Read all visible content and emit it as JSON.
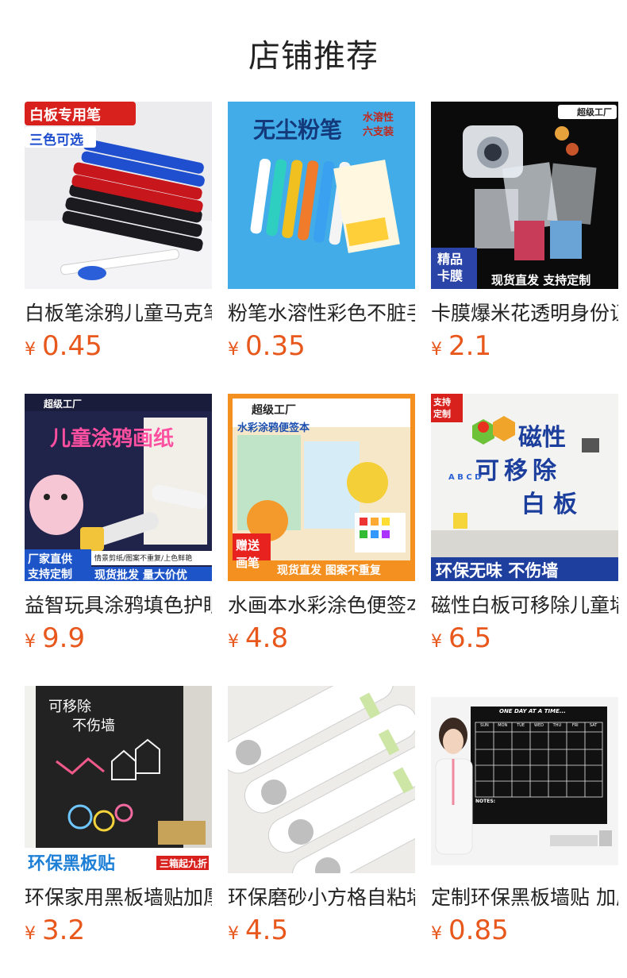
{
  "page": {
    "title": "店铺推荐",
    "currency": "¥"
  },
  "products": [
    {
      "name": "白板笔涂鸦儿童马克笔",
      "price": "0.45",
      "image_text": {
        "banner1": "白板专用笔",
        "banner2": "三色可选"
      }
    },
    {
      "name": "粉笔水溶性彩色不脏手",
      "price": "0.35",
      "image_text": {
        "title": "无尘粉笔",
        "tag": "水溶性\n六支装"
      }
    },
    {
      "name": "卡膜爆米花透明身份证",
      "price": "2.1",
      "image_text": {
        "logo": "超级工厂",
        "corner": "精品\n卡膜",
        "bottom": "现货直发 支持定制"
      }
    },
    {
      "name": "益智玩具涂鸦填色护眼",
      "price": "9.9",
      "image_text": {
        "logo": "超级工厂",
        "title": "儿童涂鸦画纸",
        "b1": "厂家直供",
        "b2": "支持定制",
        "b3": "情景剪纸/图案不重复/上色鲜艳",
        "b4": "现货批发 量大价优"
      }
    },
    {
      "name": "水画本水彩涂色便签本",
      "price": "4.8",
      "image_text": {
        "logo": "超级工厂",
        "subtitle": "水彩涂鸦便签本",
        "gift": "赠送\n画笔",
        "bottom": "现货直发 图案不重复"
      }
    },
    {
      "name": "磁性白板可移除儿童墙贴",
      "price": "6.5",
      "image_text": {
        "corner": "支持\n定制",
        "t1": "磁性",
        "t2": "可移除",
        "t3": "白板",
        "abc": "A B C D",
        "bottom": "环保无味 不伤墙"
      }
    },
    {
      "name": "环保家用黑板墙贴加厚",
      "price": "3.2",
      "image_text": {
        "t1": "可移除",
        "t2": "不伤墙",
        "bottom": "环保黑板贴",
        "promo": "三箱起九折"
      }
    },
    {
      "name": "环保磨砂小方格自粘墙贴",
      "price": "4.5",
      "image_text": {}
    },
    {
      "name": "定制环保黑板墙贴 加厚",
      "price": "0.85",
      "image_text": {
        "header": "ONE DAY AT A TIME...",
        "days": [
          "SUN",
          "MON",
          "TUE",
          "WED",
          "THU",
          "FRI",
          "SAT"
        ],
        "notes": "NOTES:"
      }
    }
  ]
}
